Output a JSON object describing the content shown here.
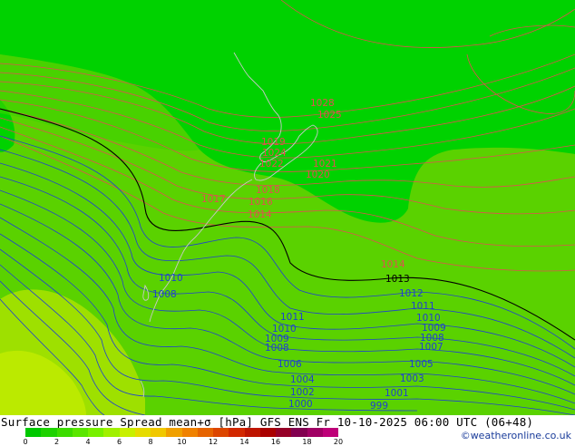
{
  "title": "Surface pressure Spread mean+σ [hPa] GFS ENS  Fr 10-10-2025 06:00 UTC (06+48)",
  "credit": "©weatheronline.co.uk",
  "colorbar": {
    "colors": [
      "#00c800",
      "#1ed200",
      "#3cdc00",
      "#5ae600",
      "#78f000",
      "#a0f000",
      "#c8f000",
      "#e6dc00",
      "#f0c800",
      "#f0a000",
      "#f08200",
      "#e66400",
      "#dc4600",
      "#d22800",
      "#be1400",
      "#aa0000",
      "#960028",
      "#820050",
      "#a00064",
      "#be0078"
    ],
    "tick_labels": [
      "0",
      "2",
      "4",
      "6",
      "8",
      "10",
      "12",
      "14",
      "16",
      "18",
      "20"
    ]
  },
  "map": {
    "isobar_labels": [
      {
        "text": "1028",
        "color": "red"
      },
      {
        "text": "1025",
        "color": "red"
      },
      {
        "text": "1024",
        "color": "red"
      },
      {
        "text": "1022",
        "color": "red"
      },
      {
        "text": "1021",
        "color": "red"
      },
      {
        "text": "1020",
        "color": "red"
      },
      {
        "text": "1019",
        "color": "red"
      },
      {
        "text": "1018",
        "color": "red"
      },
      {
        "text": "1017",
        "color": "red"
      },
      {
        "text": "1016",
        "color": "red"
      },
      {
        "text": "1014",
        "color": "red"
      },
      {
        "text": "1014",
        "color": "red"
      },
      {
        "text": "1013",
        "color": "black"
      },
      {
        "text": "1012",
        "color": "blue"
      },
      {
        "text": "1011",
        "color": "blue"
      },
      {
        "text": "1011",
        "color": "blue"
      },
      {
        "text": "1010",
        "color": "blue"
      },
      {
        "text": "1010",
        "color": "blue"
      },
      {
        "text": "1010",
        "color": "blue"
      },
      {
        "text": "1009",
        "color": "blue"
      },
      {
        "text": "1009",
        "color": "blue"
      },
      {
        "text": "1008",
        "color": "blue"
      },
      {
        "text": "1008",
        "color": "blue"
      },
      {
        "text": "1008",
        "color": "blue"
      },
      {
        "text": "1007",
        "color": "blue"
      },
      {
        "text": "1006",
        "color": "blue"
      },
      {
        "text": "1005",
        "color": "blue"
      },
      {
        "text": "1004",
        "color": "blue"
      },
      {
        "text": "1003",
        "color": "blue"
      },
      {
        "text": "1002",
        "color": "blue"
      },
      {
        "text": "1001",
        "color": "blue"
      },
      {
        "text": "1000",
        "color": "blue"
      },
      {
        "text": "999",
        "color": "blue"
      }
    ],
    "line_colors": {
      "red": "#e05050",
      "black": "#000000",
      "blue": "#2040d0",
      "coast": "#c8c8c8"
    },
    "fill_colors": {
      "base": "#5ad200",
      "bright": "#00d200",
      "mid": "#3cd200",
      "yellow": "#9ee000",
      "pale": "#c8ee00"
    }
  }
}
